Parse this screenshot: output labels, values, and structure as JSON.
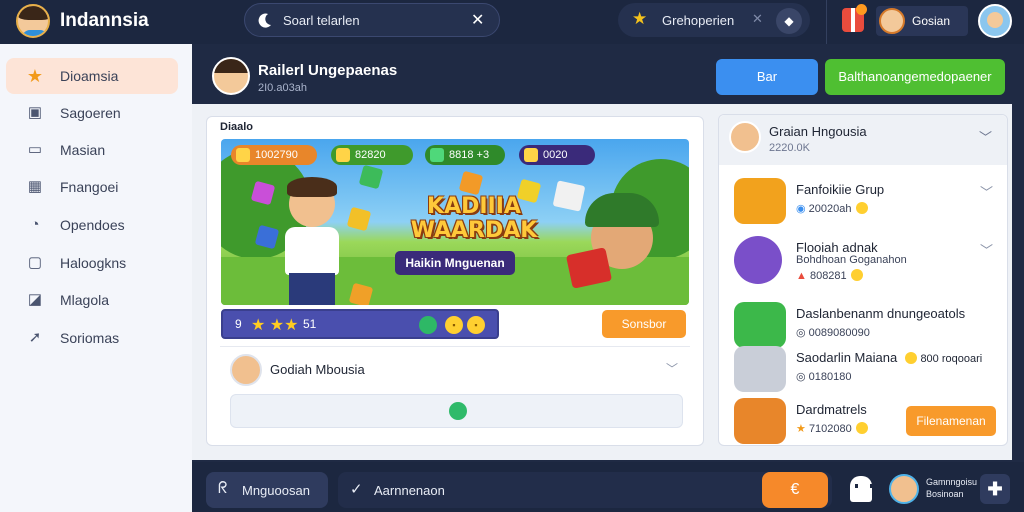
{
  "app": {
    "title": "Indannsia"
  },
  "search": {
    "placeholder": "Soarl telarlen",
    "clear_icon": "close-icon",
    "icon": "moon-search-icon"
  },
  "top_menu": {
    "label": "Grehoperien",
    "icon": "star-icon"
  },
  "user": {
    "name": "Gosian"
  },
  "sidebar": {
    "items": [
      {
        "label": "Dioamsia",
        "icon": "star-icon",
        "active": true
      },
      {
        "label": "Sagoeren",
        "icon": "folder-icon"
      },
      {
        "label": "Masian",
        "icon": "card-icon"
      },
      {
        "label": "Fnangoei",
        "icon": "grid-icon"
      },
      {
        "label": "Opendoes",
        "icon": "clock-icon"
      },
      {
        "label": "Haloogkns",
        "icon": "image-icon"
      },
      {
        "label": "Mlagola",
        "icon": "chat-icon"
      },
      {
        "label": "Soriomas",
        "icon": "pin-icon"
      }
    ]
  },
  "header": {
    "title": "Railerl Ungepaenas",
    "subtitle": "2I0.a03ah",
    "btn_primary": "Bar",
    "btn_secondary": "Balthanoangemedopaener"
  },
  "game": {
    "card_title": "Diaalo",
    "banner_title_line1": "KADIIIA",
    "banner_title_line2": "WAARDAK",
    "banner_subtitle": "Haikin Mnguenan",
    "pills": [
      "1002790",
      "82820",
      "8818 +3",
      "0020"
    ],
    "stats_text": "9",
    "stats_tail": "51",
    "action": "Sonsbor",
    "comment_user": "Godiah Mbousia"
  },
  "right_panel": {
    "head_title": "Graian Hngousia",
    "head_sub": "2220.0K",
    "items": [
      {
        "title": "Fanfoikiie Grup",
        "sub": "20020ah"
      },
      {
        "title": "Flooiah adnak",
        "sub_line1": "Bohdhoan Goganahon",
        "sub_line2": "808281"
      },
      {
        "title": "Daslanbenanm dnungeoatols",
        "sub": "0089080090"
      },
      {
        "title": "Saodarlin Maiana",
        "sub_extra": "800 roqooari",
        "sub": "0180180"
      },
      {
        "title": "Dardmatrels",
        "sub": "7102080",
        "action": "Filenamenan"
      }
    ]
  },
  "bottom_bar": {
    "pill1": "Mnguoosan",
    "pill2": "Aarnnenaon",
    "user_line1": "Gamnngoisu",
    "user_line2": "Bosinoan"
  }
}
